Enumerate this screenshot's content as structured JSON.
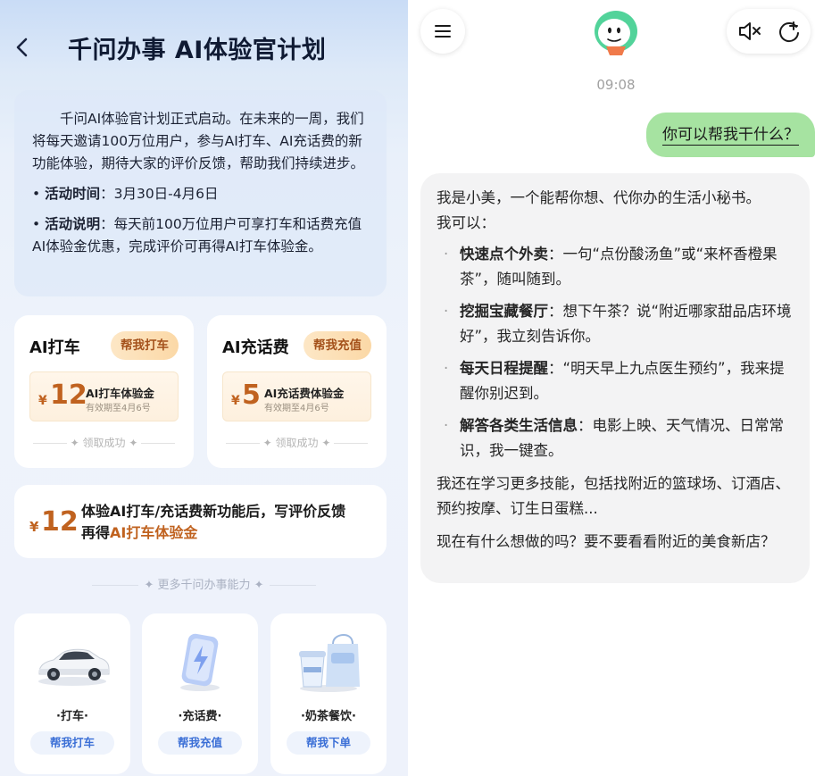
{
  "left": {
    "title": "千问办事 AI体验官计划",
    "intro": {
      "text": "千问AI体验官计划正式启动。在未来的一周，我们将每天邀请100万位用户，参与AI打车、AI充话费的新功能体验，期待大家的评价反馈，帮助我们持续进步。",
      "time_label": "活动时间",
      "time_value": "：3月30日-4月6日",
      "desc_label": "活动说明",
      "desc_value": "：每天前100万位用户可享打车和话费充值AI体验金优惠，完成评价可再得AI打车体验金。"
    },
    "promos": [
      {
        "title": "AI打车",
        "button": "帮我打车",
        "yen": "¥",
        "amount": "12",
        "coupon_name": "AI打车体验金",
        "expiry": "有效期至4月6号",
        "status": "领取成功"
      },
      {
        "title": "AI充话费",
        "button": "帮我充值",
        "yen": "¥",
        "amount": "5",
        "coupon_name": "AI充话费体验金",
        "expiry": "有效期至4月6号",
        "status": "领取成功"
      }
    ],
    "review": {
      "yen": "¥",
      "amount": "12",
      "text_line1": "体验AI打车/充话费新功能后，写评价反馈",
      "text_line2_prefix": "再得",
      "text_line2_highlight": "AI打车体验金"
    },
    "more_divider": "更多千问办事能力",
    "services": [
      {
        "name": "·打车·",
        "button": "帮我打车",
        "icon": "car-icon"
      },
      {
        "name": "·充话费·",
        "button": "帮我充值",
        "icon": "phone-charge-icon"
      },
      {
        "name": "·奶茶餐饮·",
        "button": "帮我下单",
        "icon": "milk-tea-icon"
      }
    ]
  },
  "right": {
    "timestamp": "09:08",
    "user_message": "你可以帮我干什么？",
    "bot": {
      "intro_line1": "我是小美，一个能帮你想、代你办的生活小秘书。",
      "intro_line2": "我可以：",
      "items": [
        {
          "label": "快速点个外卖",
          "text": "：一句“点份酸汤鱼”或“来杯香橙果茶”，随叫随到。"
        },
        {
          "label": "挖掘宝藏餐厅",
          "text": "：想下午茶？说“附近哪家甜品店环境好”，我立刻告诉你。"
        },
        {
          "label": "每天日程提醒",
          "text": "：“明天早上九点医生预约”，我来提醒你别迟到。"
        },
        {
          "label": "解答各类生活信息",
          "text": "：电影上映、天气情况、日常常识，我一键查。"
        }
      ],
      "para2": "我还在学习更多技能，包括找附近的篮球场、订酒店、预约按摩、订生日蛋糕...",
      "para3": "现在有什么想做的吗？要不要看看附近的美食新店？"
    }
  },
  "colors": {
    "accent_orange": "#c0621f",
    "user_bubble": "#a6e3a1",
    "link_blue": "#3b6fd6"
  }
}
